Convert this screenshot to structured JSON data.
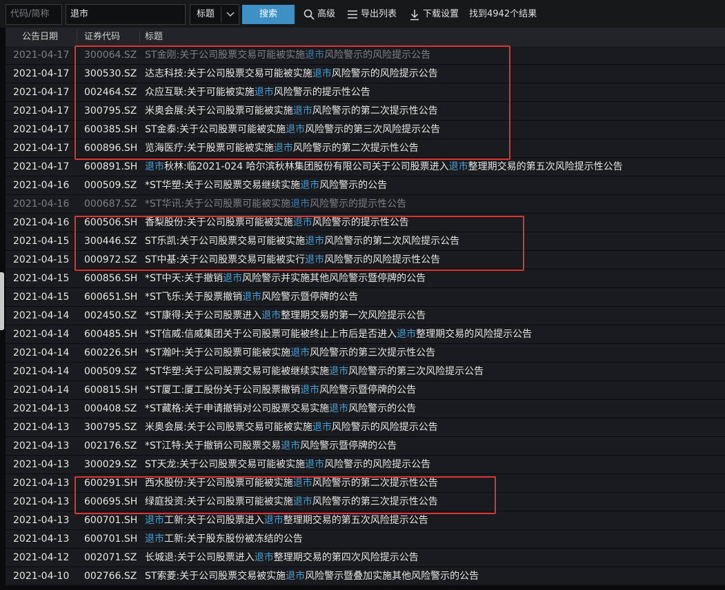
{
  "search": {
    "code_placeholder": "代码/简称",
    "keyword_value": "退市",
    "field_select": "标题",
    "search_button": "搜索",
    "advanced": "高级",
    "export_list": "导出列表",
    "download_settings": "下载设置",
    "result_count": "找到4942个结果"
  },
  "columns": [
    "公告日期",
    "证券代码",
    "标题"
  ],
  "highlight_color": "#4a9fd8",
  "rows": [
    {
      "date": "2021-04-17",
      "code": "300064.SZ",
      "pre": "ST金刚:关于公司股票交易可能被实施",
      "kw": "退市",
      "post": "风险警示的风险提示公告",
      "dim": true
    },
    {
      "date": "2021-04-17",
      "code": "300530.SZ",
      "pre": "达志科技:关于公司股票交易可能被实施",
      "kw": "退市",
      "post": "风险警示的风险提示公告"
    },
    {
      "date": "2021-04-17",
      "code": "002464.SZ",
      "pre": "众应互联:关于可能被实施",
      "kw": "退市",
      "post": "风险警示的提示性公告"
    },
    {
      "date": "2021-04-17",
      "code": "300795.SZ",
      "pre": "米奥会展:关于公司股票可能被实施",
      "kw": "退市",
      "post": "风险警示的第二次提示性公告"
    },
    {
      "date": "2021-04-17",
      "code": "600385.SH",
      "pre": "ST金泰:关于公司股票可能被实施",
      "kw": "退市",
      "post": "风险警示的第三次风险提示公告"
    },
    {
      "date": "2021-04-17",
      "code": "600896.SH",
      "pre": "览海医疗:关于股票可能被实施",
      "kw": "退市",
      "post": "风险警示的第二次提示性公告"
    },
    {
      "date": "2021-04-17",
      "code": "600891.SH",
      "pre": "",
      "kw": "退市",
      "post": "秋林:临2021-024 哈尔滨秋林集团股份有限公司关于公司股票进入",
      "kw2": "退市",
      "post2": "整理期交易的第五次风险提示性公告"
    },
    {
      "date": "2021-04-16",
      "code": "000509.SZ",
      "pre": "*ST华塑:关于公司股票交易继续实施",
      "kw": "退市",
      "post": "风险警示的公告"
    },
    {
      "date": "2021-04-16",
      "code": "000687.SZ",
      "pre": "*ST华讯:关于公司股票可能被实施",
      "kw": "退市",
      "post": "风险警示的提示性公告",
      "dim": true
    },
    {
      "date": "2021-04-16",
      "code": "600506.SH",
      "pre": "香梨股份:关于公司股票可能被实施",
      "kw": "退市",
      "post": "风险警示的提示性公告"
    },
    {
      "date": "2021-04-15",
      "code": "300446.SZ",
      "pre": "ST乐凯:关于公司股票交易可能被实施",
      "kw": "退市",
      "post": "风险警示的第二次风险提示公告"
    },
    {
      "date": "2021-04-15",
      "code": "000972.SZ",
      "pre": "ST中基:关于公司股票交易可能被实行",
      "kw": "退市",
      "post": "风险警示的风险提示性公告"
    },
    {
      "date": "2021-04-15",
      "code": "600856.SH",
      "pre": "*ST中天:关于撤销",
      "kw": "退市",
      "post": "风险警示并实施其他风险警示暨停牌的公告"
    },
    {
      "date": "2021-04-15",
      "code": "600651.SH",
      "pre": "*ST飞乐:关于股票撤销",
      "kw": "退市",
      "post": "风险警示暨停牌的公告"
    },
    {
      "date": "2021-04-14",
      "code": "002450.SZ",
      "pre": "*ST康得:关于公司股票进入",
      "kw": "退市",
      "post": "整理期交易的第一次风险提示公告"
    },
    {
      "date": "2021-04-14",
      "code": "600485.SH",
      "pre": "*ST信威:信威集团关于公司股票可能被终止上市后是否进入",
      "kw": "退市",
      "post": "整理期交易的风险提示公告"
    },
    {
      "date": "2021-04-14",
      "code": "600226.SH",
      "pre": "*ST瀚叶:关于公司股票可能被实施",
      "kw": "退市",
      "post": "风险警示的第三次提示性公告"
    },
    {
      "date": "2021-04-14",
      "code": "000509.SZ",
      "pre": "*ST华塑:关于公司股票交易可能被继续实施",
      "kw": "退市",
      "post": "风险警示的第三次风险提示公告"
    },
    {
      "date": "2021-04-14",
      "code": "600815.SH",
      "pre": "*ST厦工:厦工股份关于公司股票撤销",
      "kw": "退市",
      "post": "风险警示暨停牌的公告"
    },
    {
      "date": "2021-04-13",
      "code": "000408.SZ",
      "pre": "*ST藏格:关于申请撤销对公司股票交易实施",
      "kw": "退市",
      "post": "风险警示的公告"
    },
    {
      "date": "2021-04-13",
      "code": "300795.SZ",
      "pre": "米奥会展:关于公司股票交易可能被实施",
      "kw": "退市",
      "post": "风险警示的风险提示公告"
    },
    {
      "date": "2021-04-13",
      "code": "002176.SZ",
      "pre": "*ST江特:关于撤销公司股票交易",
      "kw": "退市",
      "post": "风险警示暨停牌的公告"
    },
    {
      "date": "2021-04-13",
      "code": "300029.SZ",
      "pre": "ST天龙:关于公司股票交易可能被实施",
      "kw": "退市",
      "post": "风险警示的风险提示公告"
    },
    {
      "date": "2021-04-13",
      "code": "600291.SH",
      "pre": "西水股份:关于公司股票可能被实施",
      "kw": "退市",
      "post": "风险警示的第二次提示性公告"
    },
    {
      "date": "2021-04-13",
      "code": "600695.SH",
      "pre": "绿庭投资:关于公司股票可能被实施",
      "kw": "退市",
      "post": "风险警示的第三次提示性公告"
    },
    {
      "date": "2021-04-13",
      "code": "600701.SH",
      "pre": "",
      "kw": "退市",
      "post": "工新:关于公司股票进入",
      "kw2": "退市",
      "post2": "整理期交易的第五次风险提示公告"
    },
    {
      "date": "2021-04-13",
      "code": "600701.SH",
      "pre": "",
      "kw": "退市",
      "post": "工新:关于股东股份被冻结的公告"
    },
    {
      "date": "2021-04-12",
      "code": "002071.SZ",
      "pre": "长城退:关于公司股票进入",
      "kw": "退市",
      "post": "整理期交易的第四次风险提示公告"
    },
    {
      "date": "2021-04-10",
      "code": "002766.SZ",
      "pre": "ST索菱:关于公司股票交易被实施",
      "kw": "退市",
      "post": "风险警示暨叠加实施其他风险警示的公告"
    }
  ]
}
